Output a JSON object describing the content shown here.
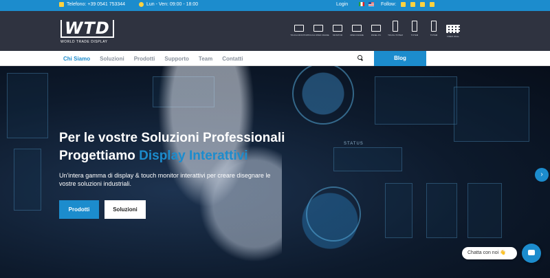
{
  "topbar": {
    "phone_label": "Telefono: +39 0541 753344",
    "hours_label": "Lun - Ven: 09:00 - 18:00",
    "login_label": "Login",
    "follow_label": "Follow:"
  },
  "header": {
    "logo_mark": "WTD",
    "logo_sub": "WORLD TRADE DISPLAY",
    "categories": [
      "TOUCH MONITOR",
      "TOUCH OPEN FRAME",
      "MONITOR",
      "OPEN FRAME",
      "PANEL PC",
      "TOUCH TOTEM",
      "TOTEM",
      "TOTEM",
      "VIDEO WALL"
    ]
  },
  "nav": {
    "items": [
      "Chi Siamo",
      "Soluzioni",
      "Prodotti",
      "Supporto",
      "Team",
      "Contatti"
    ],
    "blog_label": "Blog"
  },
  "hero": {
    "title_line1": "Per le vostre Soluzioni Professionali",
    "title_line2_prefix": "Progettiamo ",
    "title_line2_highlight": "Display Interattivi",
    "lead": "Un'intera gamma di display & touch monitor interattivi per creare disegnare le vostre soluzioni industriali.",
    "btn_primary": "Prodotti",
    "btn_secondary": "Soluzioni",
    "status_text": "STATUS"
  },
  "chat": {
    "label": "Chatta con noi 👋"
  },
  "colors": {
    "accent": "#1c8ccd",
    "header_bg": "#2f3340",
    "icon_yellow": "#ffd23f"
  }
}
